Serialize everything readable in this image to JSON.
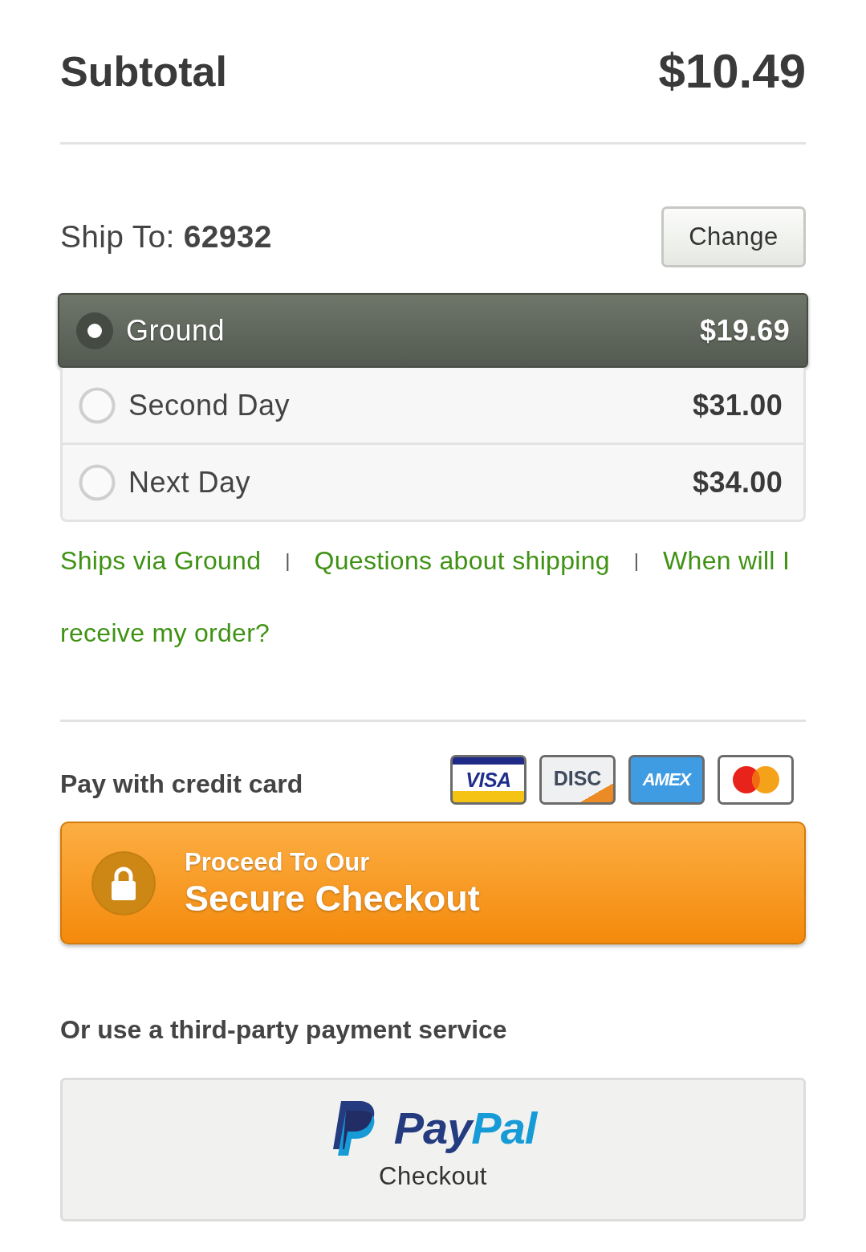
{
  "subtotal": {
    "label": "Subtotal",
    "amount": "$10.49"
  },
  "ship_to": {
    "text": "Ship To: **62932**",
    "button": "Change"
  },
  "shipping_options": [
    {
      "name": "Ground",
      "price": "$19.69",
      "selected": true
    },
    {
      "name": "Second Day",
      "price": "$31.00",
      "selected": false
    },
    {
      "name": "Next Day",
      "price": "$34.00",
      "selected": false
    }
  ],
  "help_links": [
    {
      "kind": "link",
      "lines": [
        "Ships via Ground"
      ]
    },
    {
      "kind": "separator",
      "text": "|"
    },
    {
      "kind": "link",
      "lines": [
        "Questions about shipping"
      ]
    },
    {
      "kind": "separator",
      "text": "|"
    },
    {
      "kind": "link",
      "lines": [
        "When will I",
        "receive my order?"
      ]
    }
  ],
  "credit_card": {
    "label": "Pay with credit card",
    "cards": [
      {
        "kind": "visa",
        "label": "VISA"
      },
      {
        "kind": "discover",
        "label": "DISC"
      },
      {
        "kind": "amex",
        "label": "AMEX"
      },
      {
        "kind": "mastercard"
      }
    ]
  },
  "checkout_button": {
    "line_1": "Proceed To Our",
    "line_2": "Secure Checkout"
  },
  "third_party": {
    "label": "Or use a third-party payment service",
    "paypal": {
      "wordmark": [
        "Pay",
        "Pal"
      ],
      "caption": "Checkout"
    }
  }
}
